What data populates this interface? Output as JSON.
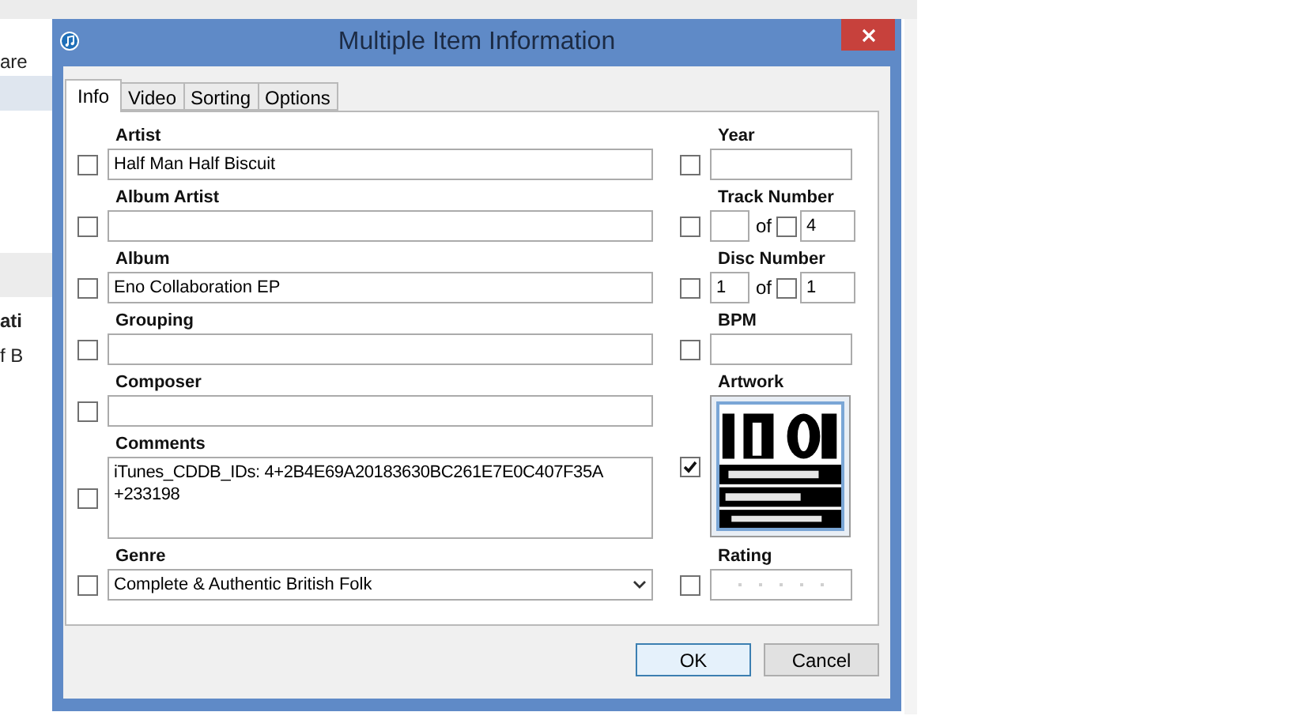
{
  "background": {
    "fragments": [
      "are",
      "ati",
      "f B"
    ]
  },
  "dialog": {
    "title": "Multiple Item Information",
    "tabs": [
      {
        "label": "Info",
        "selected": true
      },
      {
        "label": "Video",
        "selected": false
      },
      {
        "label": "Sorting",
        "selected": false
      },
      {
        "label": "Options",
        "selected": false
      }
    ],
    "left_fields": [
      {
        "kind": "text",
        "label": "Artist",
        "checked": false,
        "value": "Half Man Half Biscuit"
      },
      {
        "kind": "text",
        "label": "Album Artist",
        "checked": false
      },
      {
        "kind": "text",
        "label": "Album",
        "checked": false,
        "value": "Eno Collaboration EP"
      },
      {
        "kind": "text",
        "label": "Grouping",
        "checked": false
      },
      {
        "kind": "text",
        "label": "Composer",
        "checked": false
      },
      {
        "kind": "textarea",
        "label": "Comments",
        "checked": false,
        "value": "iTunes_CDDB_IDs: 4+2B4E69A20183630BC261E7E0C407F35A\n+233198"
      },
      {
        "kind": "select",
        "label": "Genre",
        "checked": false,
        "value": "Complete & Authentic British Folk"
      }
    ],
    "right_fields": [
      {
        "kind": "text",
        "label": "Year",
        "checked": false
      },
      {
        "kind": "pair",
        "label": "Track Number",
        "checked": false,
        "of": "of",
        "total_checked": false,
        "total": "4"
      },
      {
        "kind": "pair",
        "label": "Disc Number",
        "checked": false,
        "number": "1",
        "of": "of",
        "total_checked": false,
        "total": "1"
      },
      {
        "kind": "text",
        "label": "BPM",
        "checked": false
      },
      {
        "kind": "picture",
        "label": "Artwork",
        "checked": true
      },
      {
        "kind": "rating",
        "label": "Rating",
        "checked": false,
        "stars": 0
      }
    ],
    "buttons": [
      {
        "label": "OK",
        "default": true
      },
      {
        "label": "Cancel",
        "default": false
      }
    ]
  }
}
